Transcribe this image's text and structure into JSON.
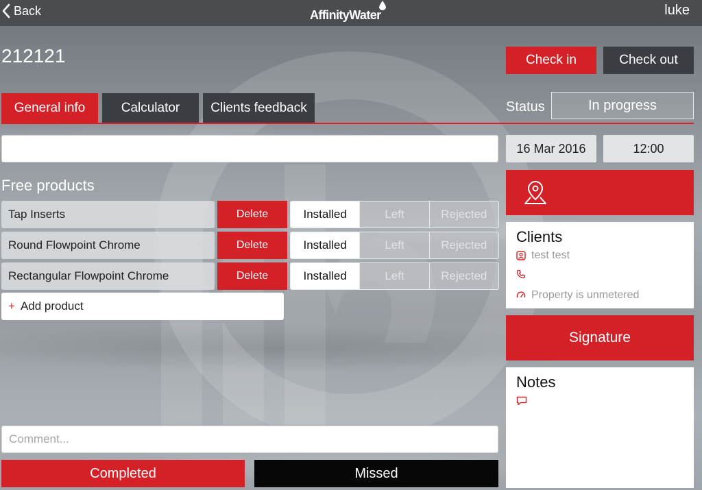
{
  "topbar": {
    "back_label": "Back",
    "brand": "AffinityWater",
    "user": "luke"
  },
  "job": {
    "id": "212121",
    "check_in_label": "Check in",
    "check_out_label": "Check out"
  },
  "tabs": [
    {
      "label": "General info",
      "active": true
    },
    {
      "label": "Calculator",
      "active": false
    },
    {
      "label": "Clients feedback",
      "active": false
    }
  ],
  "status": {
    "label": "Status",
    "value": "In progress"
  },
  "schedule": {
    "date": "16 Mar 2016",
    "time": "12:00"
  },
  "free_products": {
    "title": "Free products",
    "delete_label": "Delete",
    "segment_options": [
      "Installed",
      "Left",
      "Rejected"
    ],
    "items": [
      {
        "name": "Tap Inserts",
        "selected": "Installed"
      },
      {
        "name": "Round Flowpoint Chrome",
        "selected": "Installed"
      },
      {
        "name": "Rectangular Flowpoint Chrome",
        "selected": "Installed"
      }
    ],
    "add_label": "Add product"
  },
  "comment": {
    "placeholder": "Comment..."
  },
  "actions": {
    "completed_label": "Completed",
    "missed_label": "Missed"
  },
  "clients": {
    "title": "Clients",
    "name": "test test",
    "phone": "",
    "meter": "Property is unmetered"
  },
  "signature_label": "Signature",
  "notes": {
    "title": "Notes"
  },
  "colors": {
    "accent_red": "#d42127",
    "dark_button": "#3a3d41",
    "topbar": "#4a4d50"
  },
  "icons": [
    "chevron-left-icon",
    "water-drop-icon",
    "map-pin-icon",
    "user-icon",
    "phone-icon",
    "meter-icon",
    "comment-icon"
  ]
}
